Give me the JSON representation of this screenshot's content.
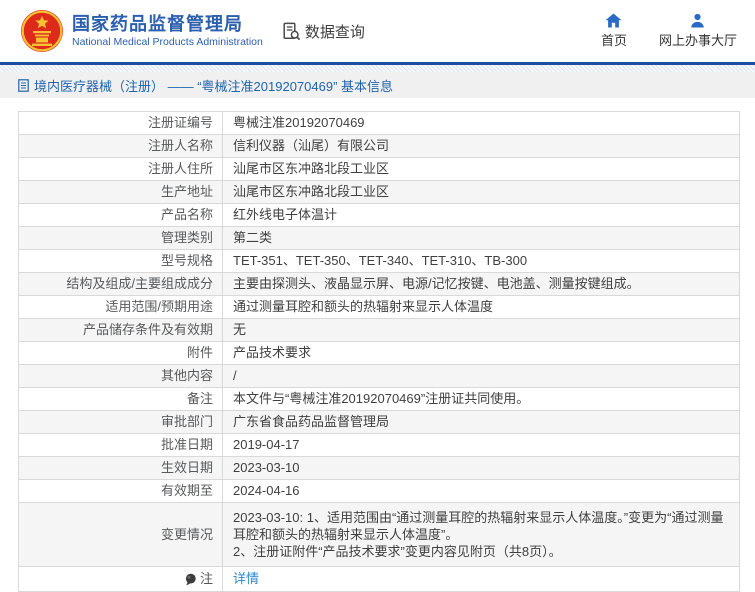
{
  "header": {
    "org_name_cn": "国家药品监督管理局",
    "org_name_en": "National Medical Products Administration",
    "data_query_label": "数据查询",
    "nav_home": "首页",
    "nav_hall": "网上办事大厅"
  },
  "breadcrumb": {
    "text": "境内医疗器械（注册） —— “粤械注准20192070469” 基本信息"
  },
  "table": {
    "rows": [
      {
        "label": "注册证编号",
        "value": "粤械注准20192070469"
      },
      {
        "label": "注册人名称",
        "value": "信利仪器（汕尾）有限公司"
      },
      {
        "label": "注册人住所",
        "value": "汕尾市区东冲路北段工业区"
      },
      {
        "label": "生产地址",
        "value": "汕尾市区东冲路北段工业区"
      },
      {
        "label": "产品名称",
        "value": "红外线电子体温计"
      },
      {
        "label": "管理类别",
        "value": "第二类"
      },
      {
        "label": "型号规格",
        "value": "TET-351、TET-350、TET-340、TET-310、TB-300"
      },
      {
        "label": "结构及组成/主要组成成分",
        "value": "主要由探测头、液晶显示屏、电源/记忆按键、电池盖、测量按键组成。"
      },
      {
        "label": "适用范围/预期用途",
        "value": "通过测量耳腔和额头的热辐射来显示人体温度"
      },
      {
        "label": "产品储存条件及有效期",
        "value": "无"
      },
      {
        "label": "附件",
        "value": "产品技术要求"
      },
      {
        "label": "其他内容",
        "value": "/"
      },
      {
        "label": "备注",
        "value": "本文件与“粤械注准20192070469”注册证共同使用。"
      },
      {
        "label": "审批部门",
        "value": "广东省食品药品监督管理局"
      },
      {
        "label": "批准日期",
        "value": "2019-04-17"
      },
      {
        "label": "生效日期",
        "value": "2023-03-10"
      },
      {
        "label": "有效期至",
        "value": "2024-04-16"
      },
      {
        "label": "变更情况",
        "value": "2023-03-10: 1、适用范围由“通过测量耳腔的热辐射来显示人体温度。”变更为“通过测量耳腔和额头的热辐射来显示人体温度”。\n2、注册证附件“产品技术要求”变更内容见附页（共8页）。",
        "multiline": true
      }
    ],
    "note_row": {
      "label": "注",
      "link_text": "详情"
    }
  },
  "colors": {
    "brand_blue": "#2c5fad",
    "nav_icon_blue": "#2a6bc5",
    "header_rule_blue": "#1c4fa1",
    "breadcrumb_text": "#2064ad",
    "link_blue": "#2b87cf",
    "stripe_bg": "#f5f5f5",
    "border": "#d9d9d9",
    "emblem_red": "#dd2a1b",
    "emblem_gold": "#f7c232"
  }
}
